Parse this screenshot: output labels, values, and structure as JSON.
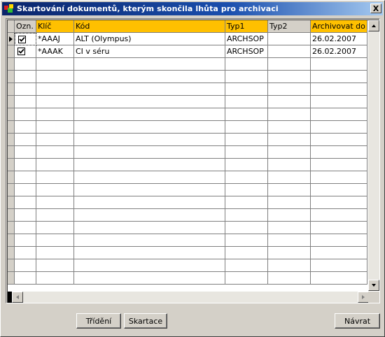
{
  "window": {
    "title": "Skartování dokumentů, kterým skončila lhůta pro archivaci",
    "close_label": "X"
  },
  "grid": {
    "columns": [
      {
        "key": "ozn",
        "label": "Ozn.",
        "highlight": false
      },
      {
        "key": "klic",
        "label": "Klíč",
        "highlight": true
      },
      {
        "key": "kod",
        "label": "Kód",
        "highlight": true
      },
      {
        "key": "typ1",
        "label": "Typ1",
        "highlight": true
      },
      {
        "key": "typ2",
        "label": "Typ2",
        "highlight": false
      },
      {
        "key": "archivovat_do",
        "label": "Archivovat do",
        "highlight": true
      }
    ],
    "rows": [
      {
        "checked": true,
        "klic": "*AAAJ",
        "kod": "ALT (Olympus)",
        "typ1": "ARCHSOP",
        "typ2": "",
        "archivovat_do": "26.02.2007",
        "current": true
      },
      {
        "checked": true,
        "klic": "*AAAK",
        "kod": "CI v séru",
        "typ1": "ARCHSOP",
        "typ2": "",
        "archivovat_do": "26.02.2007",
        "current": false
      }
    ]
  },
  "buttons": {
    "trideni": "Třídění",
    "skartace": "Skartace",
    "navrat": "Návrat"
  },
  "colors": {
    "highlight_header": "#ffc000",
    "titlebar": "#0a246a",
    "face": "#d4d0c8"
  }
}
